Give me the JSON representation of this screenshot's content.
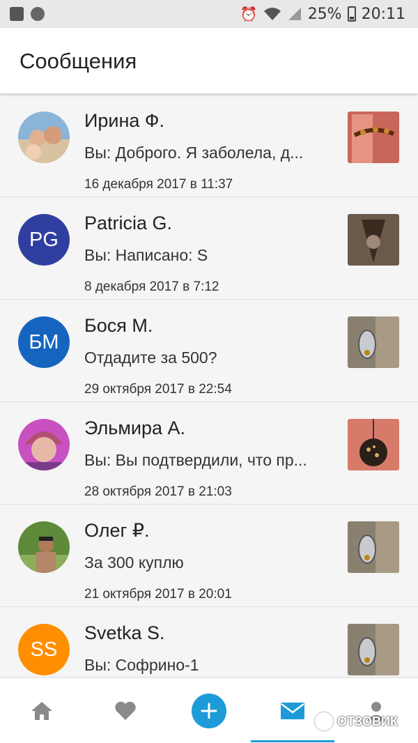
{
  "status_bar": {
    "battery_text": "25%",
    "time": "20:11",
    "icons": [
      "image-icon",
      "shield-icon",
      "alarm-icon",
      "wifi-icon",
      "signal-icon",
      "battery-icon"
    ]
  },
  "header": {
    "title": "Сообщения"
  },
  "conversations": [
    {
      "name": "Ирина Ф.",
      "preview": "Вы: Доброго. Я заболела, д...",
      "date": "16 декабря 2017 в 11:37",
      "avatar_type": "photo",
      "thumb": "bracelet"
    },
    {
      "name": "Patricia G.",
      "preview": "Вы: Написано: S",
      "date": "8 декабря 2017 в 7:12",
      "avatar_type": "initials",
      "initials": "PG",
      "avatar_color": "#303f9f",
      "thumb": "dress"
    },
    {
      "name": "Бося М.",
      "preview": "Отдадите за 500?",
      "date": "29 октября 2017 в 22:54",
      "avatar_type": "initials",
      "initials": "БМ",
      "avatar_color": "#1565c0",
      "thumb": "pendant"
    },
    {
      "name": "Эльмира А.",
      "preview": "Вы: Вы подтвердили, что пр...",
      "date": "28 октября 2017 в 21:03",
      "avatar_type": "photo",
      "thumb": "necklace"
    },
    {
      "name": "Олег ₽.",
      "preview": "За 300 куплю",
      "date": "21 октября 2017 в 20:01",
      "avatar_type": "photo",
      "thumb": "pendant"
    },
    {
      "name": "Svetka S.",
      "preview": "Вы: Софрино-1",
      "date": "",
      "avatar_type": "initials",
      "initials": "SS",
      "avatar_color": "#ff8f00",
      "thumb": "pendant"
    }
  ],
  "bottom_nav": {
    "items": [
      "home-icon",
      "heart-icon",
      "plus-icon",
      "mail-icon",
      "profile-icon"
    ],
    "active": "mail-icon",
    "accent_color": "#1d9bd8"
  },
  "watermark": {
    "text": "ОТЗОВИК"
  }
}
